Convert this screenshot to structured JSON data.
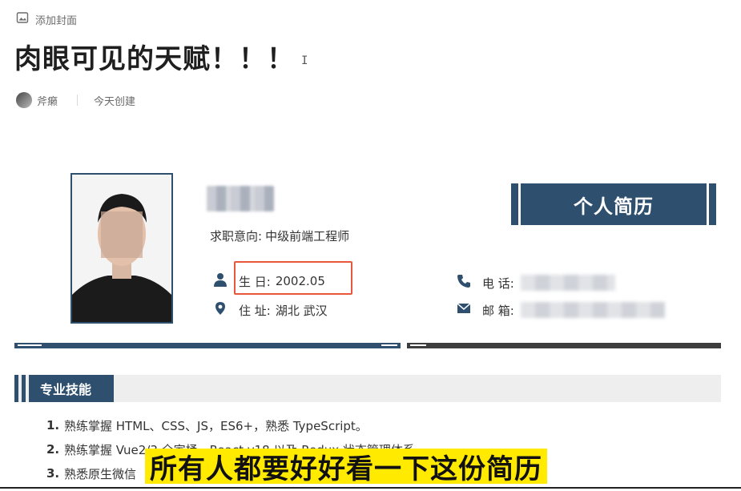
{
  "toolbar": {
    "add_cover_label": "添加封面"
  },
  "page": {
    "title": "肉眼可见的天赋！！！"
  },
  "meta": {
    "author": "斧癞",
    "created": "今天创建"
  },
  "resume": {
    "intent_label": "求职意向:",
    "intent_value": "中级前端工程师",
    "banner_title": "个人简历",
    "birthday_label": "生 日:",
    "birthday_value": "2002.05",
    "address_label": "住 址:",
    "address_value": "湖北 武汉",
    "phone_label": "电 话:",
    "email_label": "邮 箱:",
    "section_title": "专业技能",
    "skills": [
      {
        "num": "1.",
        "text": "熟练掌握 HTML、CSS、JS，ES6+，熟悉 TypeScript。"
      },
      {
        "num": "2.",
        "text": "熟练掌握 Vue2/3 全家桶，React v18 以及 Redux 状态管理体系"
      },
      {
        "num": "3.",
        "text": "熟悉原生微信"
      }
    ]
  },
  "subtitle": "所有人都要好好看一下这份简历",
  "colors": {
    "accent": "#2e4f6e",
    "highlight_box": "#e8573a",
    "subtitle_bg": "#ffea00"
  },
  "icons": [
    "image-icon",
    "user-icon",
    "location-icon",
    "phone-icon",
    "mail-icon"
  ]
}
